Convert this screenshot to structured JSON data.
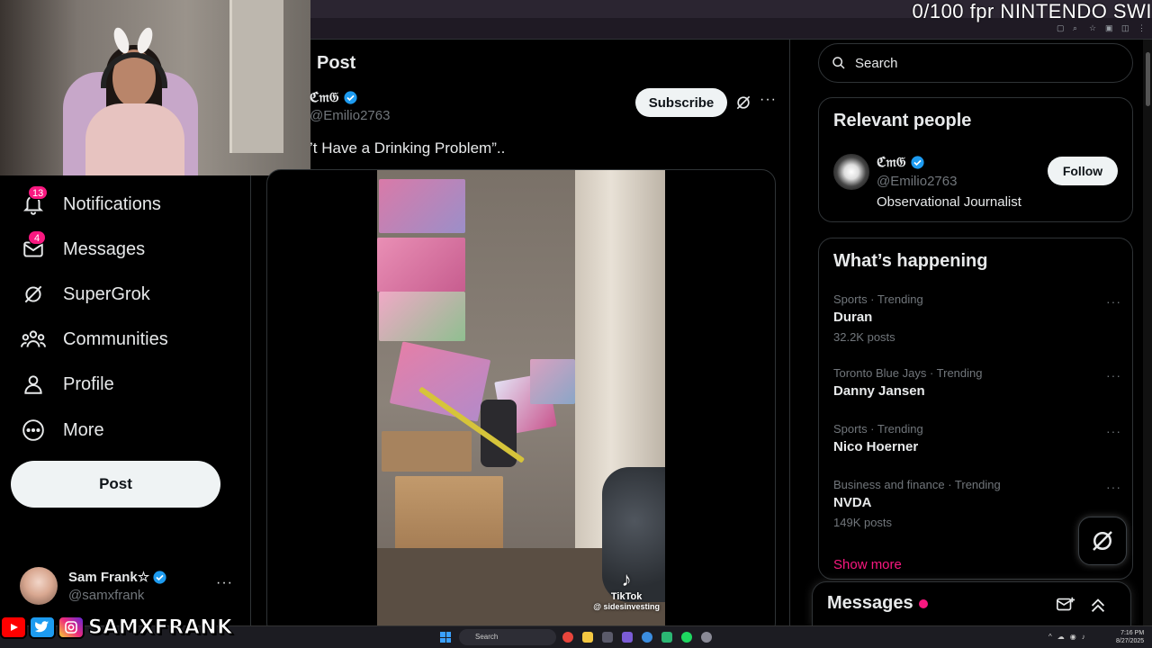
{
  "overlay": {
    "stream_text": "0/100 fpr NINTENDO SWI"
  },
  "nav": {
    "items": [
      {
        "label": "Notifications",
        "badge": "13",
        "icon": "bell-icon"
      },
      {
        "label": "Messages",
        "badge": "4",
        "icon": "envelope-icon"
      },
      {
        "label": "SuperGrok",
        "badge": null,
        "icon": "grok-icon"
      },
      {
        "label": "Communities",
        "badge": null,
        "icon": "communities-icon"
      },
      {
        "label": "Profile",
        "badge": null,
        "icon": "person-icon"
      },
      {
        "label": "More",
        "badge": null,
        "icon": "more-circle-icon"
      }
    ],
    "post_label": "Post",
    "account": {
      "name": "Sam Frank☆",
      "handle": "@samxfrank",
      "more": "···"
    }
  },
  "social": {
    "name": "SAMXFRANK"
  },
  "main": {
    "title": "Post",
    "author": {
      "name": "ℭ𝔪𝔊",
      "handle": "@Emilio2763"
    },
    "subscribe_label": "Subscribe",
    "more": "···",
    "post_text": "’t Have a Drinking Problem”..",
    "video": {
      "tiktok_label": "TikTok",
      "tiktok_user": "@ sidesinvesting"
    }
  },
  "sidebar": {
    "search": {
      "placeholder": "Search"
    },
    "relevant": {
      "title": "Relevant people",
      "person": {
        "name": "ℭ𝔪𝔊",
        "handle": "@Emilio2763",
        "bio": "Observational Journalist",
        "follow_label": "Follow"
      }
    },
    "happening": {
      "title": "What’s happening",
      "trends": [
        {
          "meta": "Sports · Trending",
          "name": "Duran",
          "count": "32.2K posts"
        },
        {
          "meta": "Toronto Blue Jays · Trending",
          "name": "Danny Jansen",
          "count": ""
        },
        {
          "meta": "Sports · Trending",
          "name": "Nico Hoerner",
          "count": ""
        },
        {
          "meta": "Business and finance · Trending",
          "name": "NVDA",
          "count": "149K posts"
        }
      ],
      "show_more": "Show more"
    },
    "messages_drawer": {
      "title": "Messages"
    }
  },
  "taskbar": {
    "search_placeholder": "Search",
    "time": "7:16 PM",
    "date": "8/27/2025"
  },
  "colors": {
    "accent": "#f91880",
    "verified": "#1d9bf0",
    "bg": "#000000",
    "border": "#2f3336",
    "muted": "#71767b"
  }
}
